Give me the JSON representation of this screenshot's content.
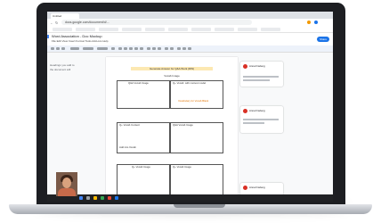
{
  "browser": {
    "tabs": [
      "Untitled"
    ],
    "url": "docs.google.com/document/d/..."
  },
  "document": {
    "title": "Word Association - Doc Mockup",
    "menus": "File  Edit  View  Insert  Format  Tools  Add-ons  Help",
    "share_label": "Share",
    "header_label": "Generate Answer for Q&A Work (RW)",
    "heading": "Vocab Image",
    "cells": {
      "top_left": "Q&A Vocab Image",
      "top_right": "Q+ Vocab: with context model",
      "top_right_sub": "Vocabulary for Vocab Blank",
      "mid_left": "Q+ Vocab Content",
      "mid_left_sub": "Add into Vocab",
      "mid_right": "Q&A Vocab Image",
      "bot_left": "Q+ Vocab Image",
      "bot_right": "Q+ Vocab Image"
    },
    "footer_label": "Follow to the lists / Work (RW) vocabulary"
  },
  "sidebar": {
    "outline_items": [
      "Headings you add to",
      "the document will"
    ]
  },
  "comments": [
    {
      "name": "Anna Frieberg"
    },
    {
      "name": "Anna Frieberg"
    },
    {
      "name": "Anna Frieberg"
    }
  ],
  "colors": {
    "accent": "#1a73e8",
    "highlight": "#fce8b2",
    "avatar": "#d93025"
  }
}
